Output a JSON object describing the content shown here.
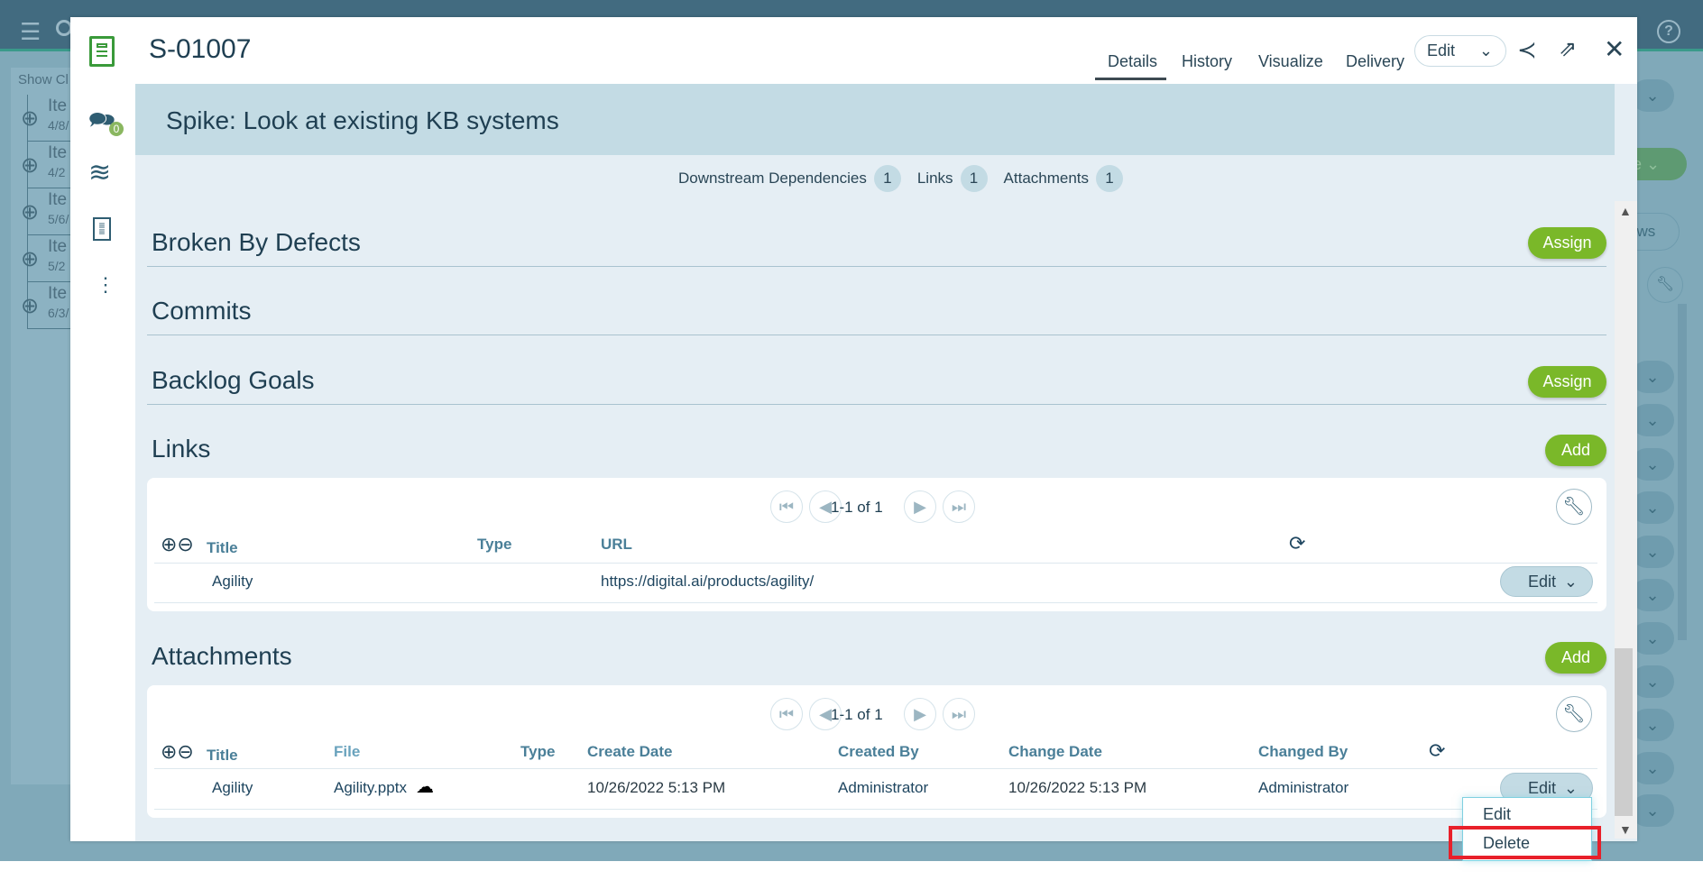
{
  "background": {
    "show_closed_label": "Show Cl",
    "items": [
      {
        "title": "Ite",
        "date": "4/8/"
      },
      {
        "title": "Ite",
        "date": "4/2"
      },
      {
        "title": "Ite",
        "date": "5/6/"
      },
      {
        "title": "Ite",
        "date": "5/2"
      },
      {
        "title": "Ite",
        "date": "6/3/"
      }
    ],
    "right_views_label": "ews",
    "right_green_label": "e"
  },
  "modal": {
    "id": "S-01007",
    "title": "Spike: Look at existing KB systems",
    "comment_count": "0",
    "tabs": [
      {
        "label": "Details",
        "active": true
      },
      {
        "label": "History"
      },
      {
        "label": "Visualize"
      },
      {
        "label": "Delivery"
      }
    ],
    "edit_label": "Edit",
    "counts": [
      {
        "label": "Downstream Dependencies",
        "value": "1"
      },
      {
        "label": "Links",
        "value": "1"
      },
      {
        "label": "Attachments",
        "value": "1"
      }
    ],
    "sections": {
      "broken_by_defects": {
        "title": "Broken By Defects",
        "button": "Assign"
      },
      "commits": {
        "title": "Commits"
      },
      "backlog_goals": {
        "title": "Backlog Goals",
        "button": "Assign"
      },
      "links": {
        "title": "Links",
        "button": "Add",
        "pager": "1-1 of 1",
        "columns": [
          "Title",
          "Type",
          "URL"
        ],
        "rows": [
          {
            "title": "Agility",
            "type": "",
            "url": "https://digital.ai/products/agility/",
            "action": "Edit"
          }
        ]
      },
      "attachments": {
        "title": "Attachments",
        "button": "Add",
        "pager": "1-1 of 1",
        "columns": [
          "Title",
          "File",
          "Type",
          "Create Date",
          "Created By",
          "Change Date",
          "Changed By"
        ],
        "rows": [
          {
            "title": "Agility",
            "file": "Agility.pptx",
            "type": "",
            "create_date": "10/26/2022 5:13 PM",
            "created_by": "Administrator",
            "change_date": "10/26/2022 5:13 PM",
            "changed_by": "Administrator",
            "action": "Edit"
          }
        ]
      }
    },
    "row_menu": {
      "items": [
        "Edit",
        "Delete"
      ],
      "highlighted": "Delete"
    }
  },
  "colors": {
    "accent_green": "#7ab829",
    "highlight_red": "#e8202a",
    "header_band": "#c3dbe4"
  }
}
